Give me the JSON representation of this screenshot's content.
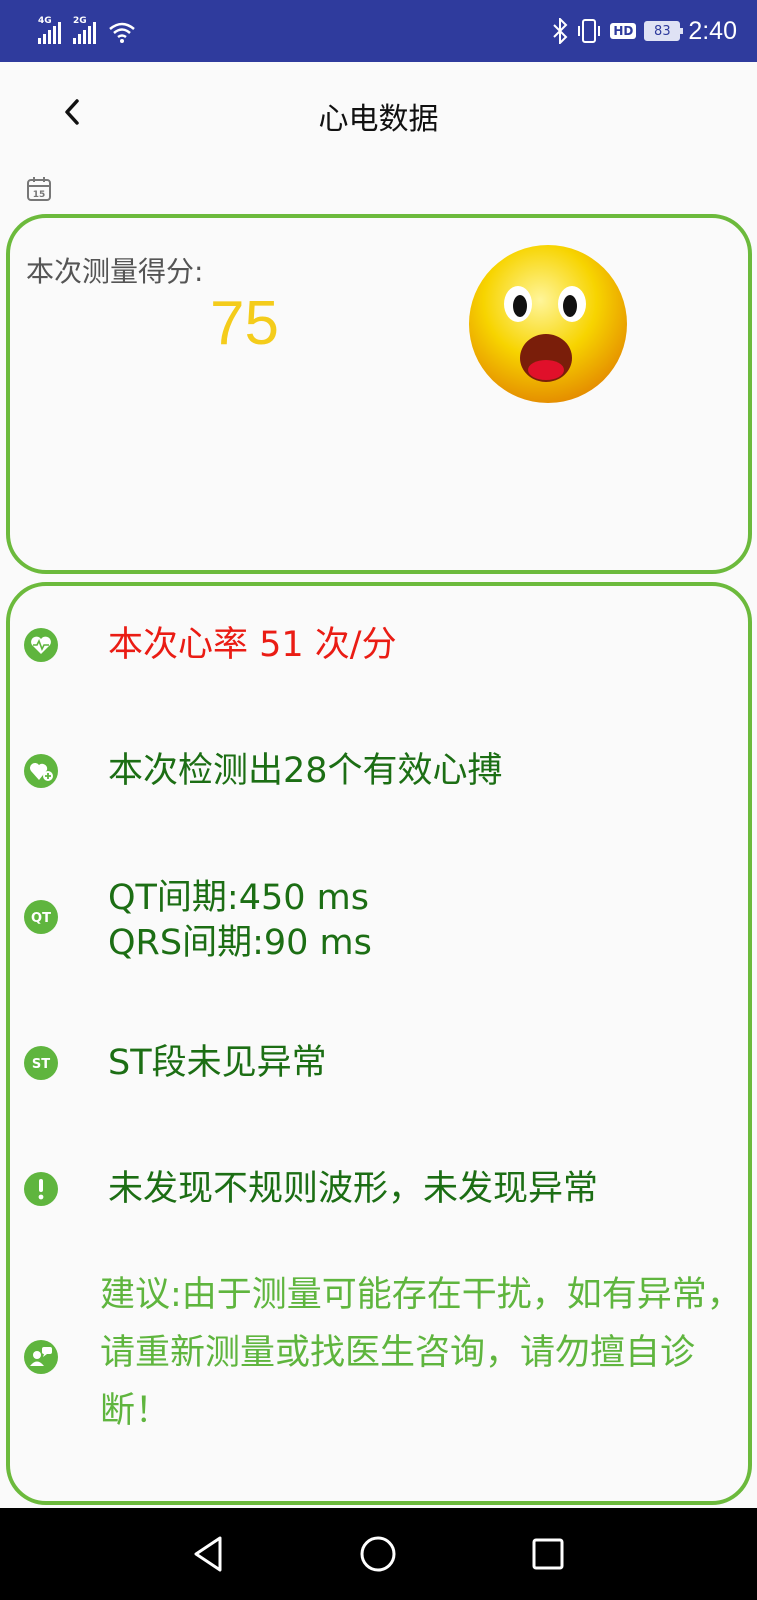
{
  "status_bar": {
    "signal1_tag": "4G",
    "signal2_tag": "2G",
    "hd_badge": "HD",
    "battery_level": "83",
    "time": "2:40",
    "icons": [
      "bluetooth-icon",
      "vibrate-icon",
      "wifi-icon"
    ]
  },
  "header": {
    "title": "心电数据",
    "back_icon": "chevron-left-icon"
  },
  "date_icon": "calendar-icon",
  "score_card": {
    "label": "本次测量得分:",
    "score": "75",
    "emoji": "shocked-face-icon",
    "score_color": "#f4cc1b"
  },
  "results": {
    "heart_rate": "本次心率 51 次/分",
    "beats": "本次检测出28个有效心搏",
    "qt_interval": "QT间期:450 ms",
    "qrs_interval": "QRS间期:90 ms",
    "st_segment": "ST段未见异常",
    "waveform": "未发现不规则波形，未发现异常",
    "advice": "建议:由于测量可能存在干扰，如有异常，请重新测量或找医生咨询，请勿擅自诊断！",
    "qt_icon_text": "QT",
    "st_icon_text": "ST"
  },
  "colors": {
    "status_bar": "#2f3b9d",
    "card_border": "#6cba3c",
    "text_green": "#1c6e14",
    "text_red": "#ea1c14",
    "text_light_green": "#5fb53e"
  }
}
